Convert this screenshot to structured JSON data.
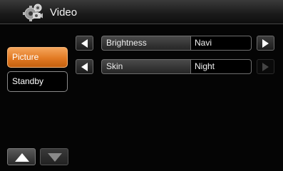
{
  "header": {
    "title": "Video",
    "icon": "gear-icon"
  },
  "menu": {
    "items": [
      {
        "label": "Picture",
        "active": true
      },
      {
        "label": "Standby",
        "active": false
      }
    ]
  },
  "settings": [
    {
      "label": "Brightness",
      "value": "Navi"
    },
    {
      "label": "Skin",
      "value": "Night"
    }
  ],
  "colors": {
    "accent": "#e27a23",
    "background": "#000000"
  }
}
